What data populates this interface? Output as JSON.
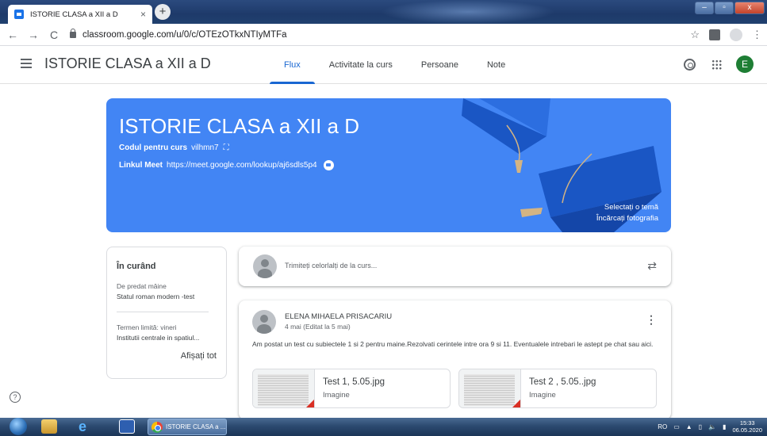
{
  "browser": {
    "tab_title": "ISTORIE CLASA a XII a D",
    "tab_close": "×",
    "new_tab": "+",
    "url": "classroom.google.com/u/0/c/OTEzOTkxNTIyMTFa",
    "nav_back": "←",
    "nav_forward": "→",
    "nav_reload": "C",
    "star": "☆",
    "menu": "⋮"
  },
  "header": {
    "title": "ISTORIE CLASA a XII a D",
    "tabs": [
      {
        "label": "Flux",
        "active": true
      },
      {
        "label": "Activitate la curs",
        "active": false
      },
      {
        "label": "Persoane",
        "active": false
      },
      {
        "label": "Note",
        "active": false
      }
    ],
    "avatar_letter": "E"
  },
  "banner": {
    "title": "ISTORIE CLASA a XII a D",
    "code_label": "Codul pentru curs",
    "code_value": "vilhmn7",
    "meet_label": "Linkul Meet",
    "meet_value": "https://meet.google.com/lookup/aj6sdls5p4",
    "select_theme": "Selectați o temă",
    "upload_photo": "Încărcați fotografia",
    "color": "#4285f4"
  },
  "upcoming": {
    "title": "În curând",
    "items": [
      {
        "due": "De predat mâine",
        "name": "Statul roman modern -test"
      },
      {
        "due": "Termen limită: vineri",
        "name": "Institutii centrale in spatiul..."
      }
    ],
    "view_all": "Afișați tot"
  },
  "compose": {
    "placeholder": "Trimiteți celorlalți de la curs..."
  },
  "post": {
    "author": "ELENA MIHAELA PRISACARIU",
    "date": "4 mai (Editat la 5 mai)",
    "text": "Am postat un test cu subiectele 1 si 2 pentru maine.Rezolvati cerintele intre ora 9 si 11. Eventualele intrebari le astept pe chat sau aici.",
    "attachments": [
      {
        "name": "Test 1, 5.05.jpg",
        "type": "Imagine"
      },
      {
        "name": "Test 2 , 5.05..jpg",
        "type": "Imagine"
      }
    ]
  },
  "help_icon": "?",
  "taskbar": {
    "task_label": "ISTORIE CLASA a ...",
    "lang": "RO",
    "time": "15:33",
    "date": "06.05.2020"
  }
}
